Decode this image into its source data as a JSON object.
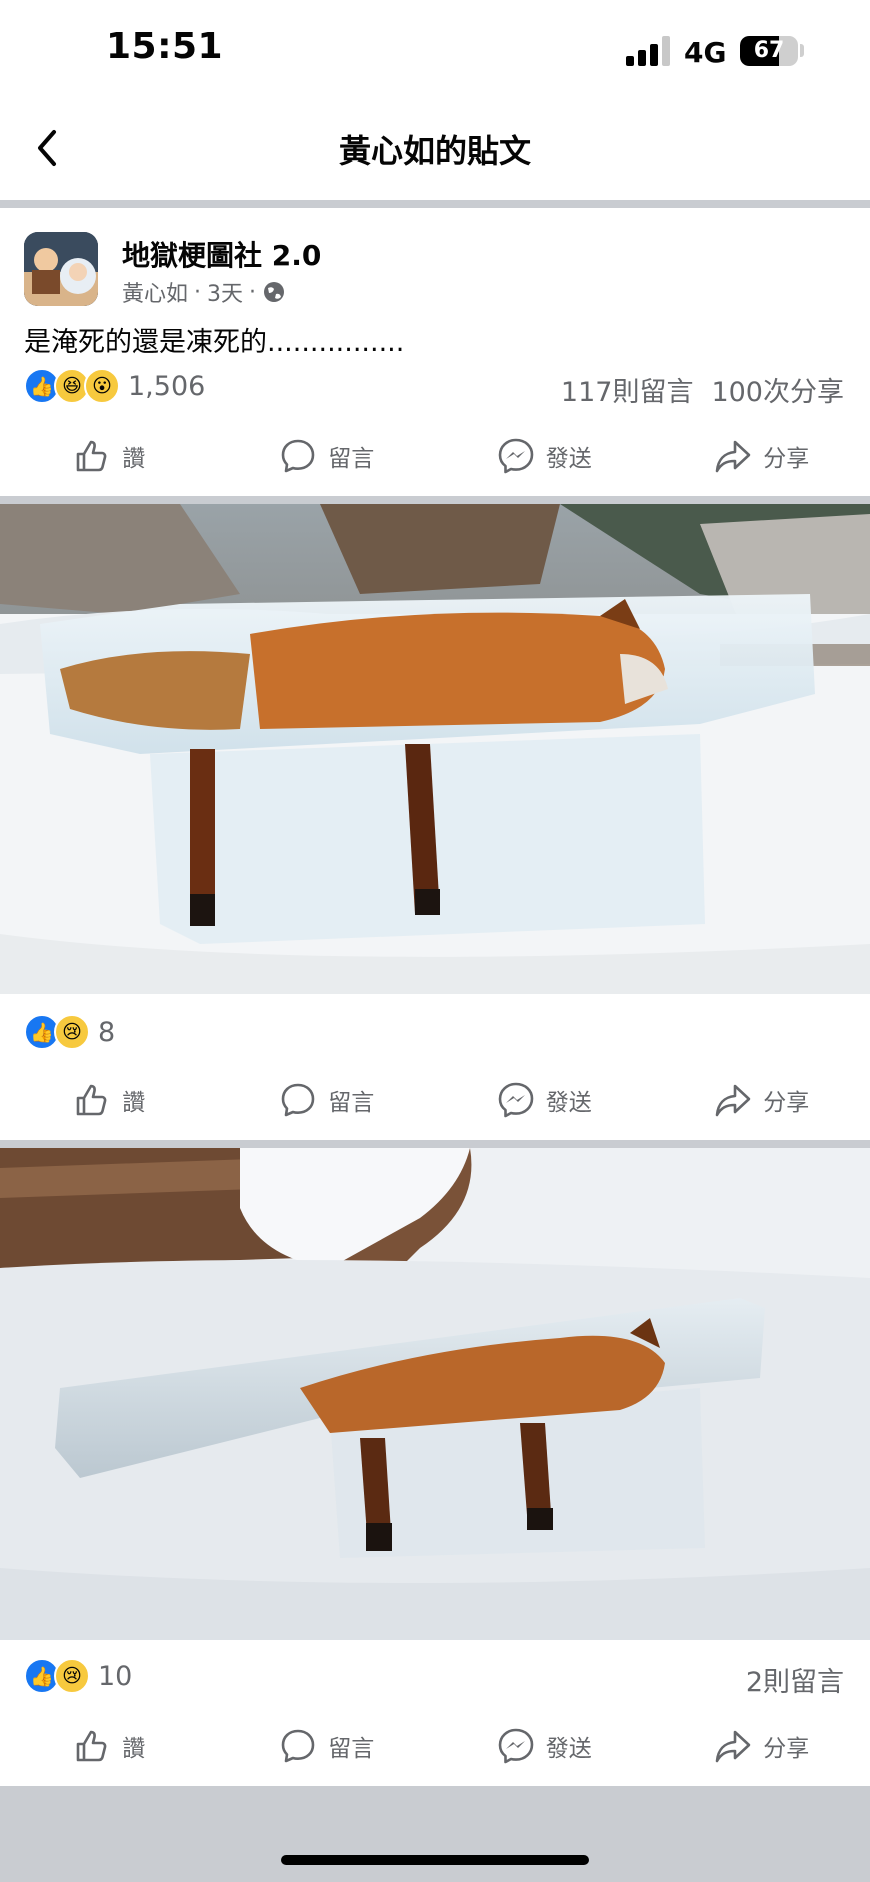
{
  "status": {
    "time": "15:51",
    "network": "4G",
    "battery": "67",
    "battery_level": 0.67
  },
  "header": {
    "title": "黃心如的貼文"
  },
  "post": {
    "group_name": "地獄梗圖社 2.0",
    "author": "黃心如",
    "time": "3天",
    "caption": "是淹死的還是凍死的................",
    "reaction_count": "1,506",
    "comments": "117則留言",
    "shares": "100次分享"
  },
  "photo1": {
    "reaction_count": "8"
  },
  "photo2": {
    "reaction_count": "10",
    "comments": "2則留言"
  },
  "actions": {
    "like": "讚",
    "comment": "留言",
    "send": "發送",
    "share": "分享"
  },
  "colors": {
    "like_blue": "#1877f2",
    "divider": "#c9ccd1",
    "secondary_text": "#65676b"
  }
}
